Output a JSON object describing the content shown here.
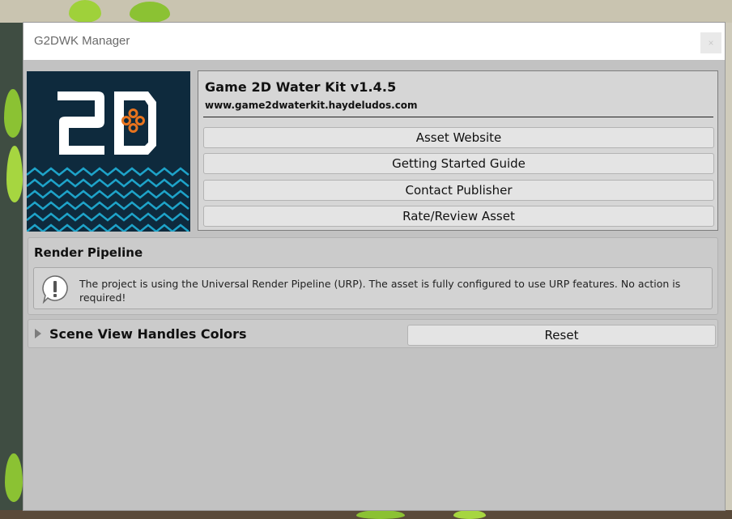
{
  "window": {
    "title": "G2DWK Manager",
    "close_glyph": "×"
  },
  "logo": {
    "icon": "game2d-water-kit-logo",
    "text": "2D",
    "colors": {
      "background": "#0e2a3d",
      "text": "#ffffff",
      "accent": "#e8741e",
      "waves": "#1ea3c9"
    }
  },
  "asset": {
    "title": "Game 2D Water Kit v1.4.5",
    "url": "www.game2dwaterkit.haydeludos.com"
  },
  "links": [
    {
      "label": "Asset Website"
    },
    {
      "label": "Getting Started Guide"
    },
    {
      "label": "Contact Publisher"
    },
    {
      "label": "Rate/Review Asset"
    }
  ],
  "render_pipeline": {
    "heading": "Render Pipeline",
    "icon": "warning-icon",
    "message": "The project is using the Universal Render Pipeline (URP). The asset is fully configured to use URP features. No action is required!"
  },
  "scene_view": {
    "label": "Scene View Handles Colors",
    "expanded": false,
    "reset_label": "Reset"
  }
}
